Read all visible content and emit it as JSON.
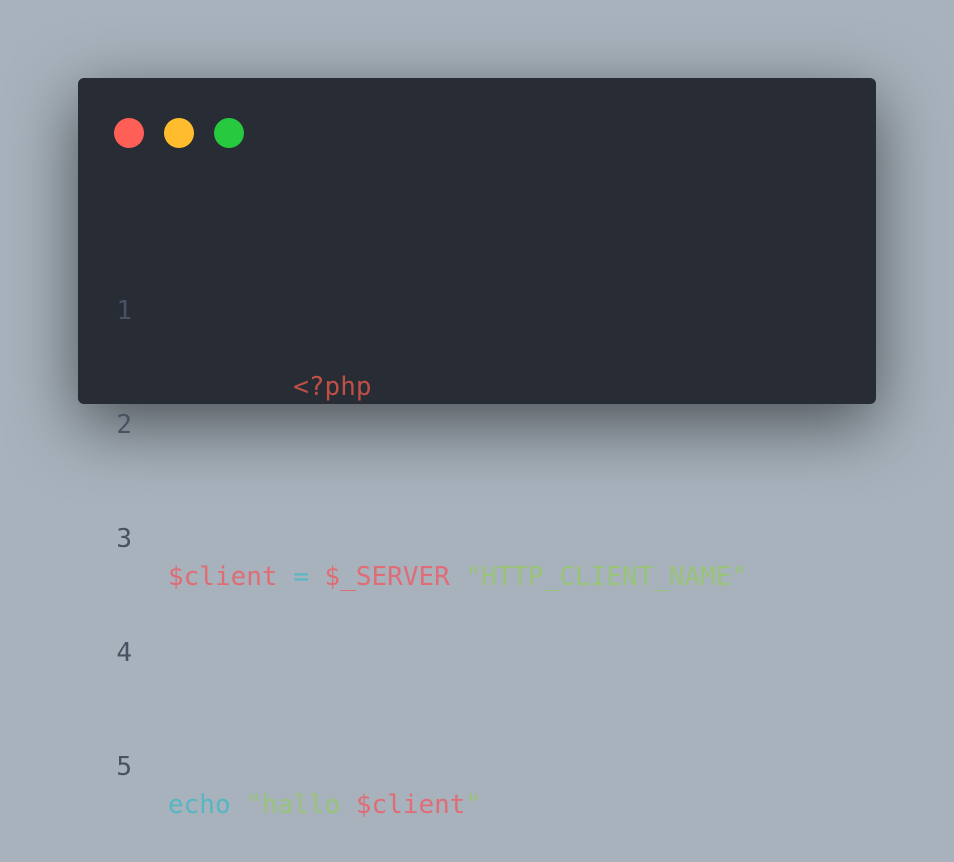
{
  "window": {
    "controls": [
      {
        "name": "close",
        "color": "#ff5f56"
      },
      {
        "name": "minimize",
        "color": "#ffbd2e"
      },
      {
        "name": "maximize",
        "color": "#27c93f"
      }
    ]
  },
  "code": {
    "language": "php",
    "colors": {
      "tag": "#be5046",
      "variable": "#e06c75",
      "operator": "#56b6c2",
      "keyword": "#56b6c2",
      "string": "#98c379",
      "punctuation": "#abb2bf",
      "line_number": "#495162"
    },
    "lines": [
      {
        "number": "1",
        "tokens": [
          {
            "type": "tag",
            "text": "<?php"
          }
        ]
      },
      {
        "number": "2",
        "tokens": []
      },
      {
        "number": "3",
        "tokens": [
          {
            "type": "variable",
            "text": "$client"
          },
          {
            "type": "punctuation",
            "text": " "
          },
          {
            "type": "operator",
            "text": "="
          },
          {
            "type": "punctuation",
            "text": " "
          },
          {
            "type": "variable",
            "text": "$_SERVER"
          },
          {
            "type": "punctuation",
            "text": "["
          },
          {
            "type": "string",
            "text": "\"HTTP_CLIENT_NAME\""
          },
          {
            "type": "punctuation",
            "text": "];"
          }
        ]
      },
      {
        "number": "4",
        "tokens": []
      },
      {
        "number": "5",
        "tokens": [
          {
            "type": "keyword",
            "text": "echo"
          },
          {
            "type": "punctuation",
            "text": " "
          },
          {
            "type": "string",
            "text": "\"hallo "
          },
          {
            "type": "variable",
            "text": "$client"
          },
          {
            "type": "string",
            "text": "\""
          },
          {
            "type": "punctuation",
            "text": ";"
          }
        ]
      }
    ]
  }
}
